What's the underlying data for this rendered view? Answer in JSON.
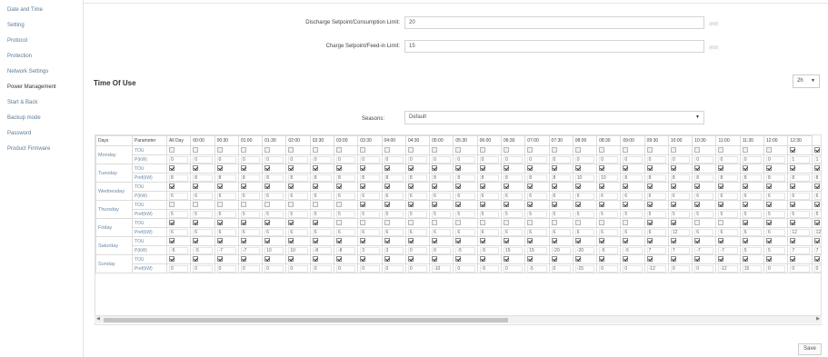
{
  "sidebar": {
    "items": [
      {
        "label": "Date and Time"
      },
      {
        "label": "Setting"
      },
      {
        "label": "Protocol"
      },
      {
        "label": "Protection"
      },
      {
        "label": "Network Settings"
      },
      {
        "label": "Power Management"
      },
      {
        "label": "Start & Back"
      },
      {
        "label": "Backup mode"
      },
      {
        "label": "Password"
      },
      {
        "label": "Product Firmware"
      }
    ]
  },
  "form": {
    "discharge_label": "Discharge Setpoint/Consumption Limit:",
    "discharge_value": "20",
    "discharge_unit": "(kW)",
    "charge_label": "Charge Setpoint/Feed-in Limit:",
    "charge_value": "15",
    "charge_unit": "(kW)"
  },
  "tou": {
    "title": "Time Of Use",
    "interval_value": "2h",
    "season_label": "Seasons:",
    "season_value": "Default"
  },
  "table": {
    "headers": [
      "Days",
      "Parameter",
      "All Day",
      "00:00",
      "00:30",
      "01:00",
      "01:30",
      "02:00",
      "02:30",
      "03:00",
      "03:30",
      "04:00",
      "04:30",
      "05:00",
      "05:30",
      "06:00",
      "06:30",
      "07:00",
      "07:30",
      "08:00",
      "08:30",
      "09:00",
      "09:30",
      "10:00",
      "10:30",
      "11:00",
      "11:30",
      "12:00",
      "12:30"
    ],
    "rows": [
      {
        "day": "Monday",
        "tou_label": "TOU",
        "pref_label": "P(kW)",
        "checks": [
          false,
          false,
          false,
          false,
          false,
          false,
          false,
          false,
          false,
          false,
          false,
          false,
          false,
          false,
          false,
          false,
          false,
          false,
          false,
          false,
          false,
          false,
          false,
          false,
          false,
          false,
          true,
          true
        ],
        "values": [
          "0",
          "0",
          "0",
          "0",
          "0",
          "0",
          "0",
          "0",
          "0",
          "0",
          "0",
          "0",
          "0",
          "0",
          "0",
          "0",
          "0",
          "0",
          "0",
          "0",
          "0",
          "0",
          "0",
          "0",
          "0",
          "0",
          "1",
          "1"
        ]
      },
      {
        "day": "Tuesday",
        "tou_label": "TOU",
        "pref_label": "Pref(kW)",
        "checks": [
          true,
          true,
          true,
          true,
          true,
          true,
          true,
          true,
          true,
          true,
          true,
          true,
          true,
          true,
          true,
          true,
          true,
          true,
          true,
          true,
          true,
          true,
          true,
          true,
          true,
          true,
          true,
          true
        ],
        "values": [
          "8",
          "8",
          "8",
          "8",
          "8",
          "8",
          "8",
          "8",
          "8",
          "8",
          "8",
          "8",
          "8",
          "8",
          "8",
          "8",
          "8",
          "10",
          "10",
          "8",
          "8",
          "8",
          "8",
          "8",
          "8",
          "8",
          "8",
          "8"
        ]
      },
      {
        "day": "Wednesday",
        "tou_label": "TOU",
        "pref_label": "P(kW)",
        "checks": [
          true,
          true,
          true,
          true,
          true,
          true,
          true,
          true,
          true,
          true,
          true,
          true,
          true,
          true,
          true,
          true,
          true,
          true,
          true,
          true,
          true,
          true,
          true,
          true,
          true,
          true,
          true,
          true
        ],
        "values": [
          "6",
          "6",
          "6",
          "6",
          "6",
          "6",
          "6",
          "6",
          "6",
          "6",
          "6",
          "6",
          "6",
          "6",
          "6",
          "6",
          "6",
          "6",
          "6",
          "6",
          "6",
          "6",
          "6",
          "6",
          "6",
          "6",
          "6",
          "6"
        ]
      },
      {
        "day": "Thursday",
        "tou_label": "TOU",
        "pref_label": "Pref(kW)",
        "checks": [
          false,
          false,
          false,
          false,
          false,
          false,
          false,
          false,
          true,
          true,
          true,
          true,
          true,
          true,
          true,
          true,
          true,
          true,
          true,
          true,
          true,
          true,
          true,
          true,
          true,
          true,
          true,
          true
        ],
        "values": [
          "5",
          "5",
          "5",
          "5",
          "5",
          "5",
          "5",
          "5",
          "5",
          "5",
          "5",
          "5",
          "5",
          "5",
          "5",
          "5",
          "5",
          "5",
          "5",
          "5",
          "5",
          "5",
          "5",
          "5",
          "5",
          "5",
          "5",
          "5"
        ]
      },
      {
        "day": "Friday",
        "tou_label": "TOU",
        "pref_label": "Pref(kW)",
        "checks": [
          true,
          true,
          true,
          true,
          true,
          true,
          true,
          false,
          false,
          false,
          false,
          false,
          false,
          false,
          false,
          false,
          false,
          false,
          false,
          false,
          true,
          true,
          false,
          false,
          true,
          true,
          true,
          true
        ],
        "values": [
          "6",
          "6",
          "6",
          "6",
          "6",
          "6",
          "6",
          "6",
          "6",
          "6",
          "6",
          "6",
          "6",
          "6",
          "6",
          "6",
          "6",
          "6",
          "6",
          "6",
          "6",
          "12",
          "6",
          "6",
          "6",
          "6",
          "12",
          "12"
        ]
      },
      {
        "day": "Saturday",
        "tou_label": "TOU",
        "pref_label": "P(kW)",
        "checks": [
          true,
          true,
          true,
          true,
          true,
          true,
          true,
          true,
          true,
          true,
          true,
          true,
          true,
          true,
          true,
          true,
          true,
          true,
          true,
          true,
          true,
          true,
          true,
          true,
          true,
          true,
          true,
          true
        ],
        "values": [
          "-5",
          "-5",
          "-7",
          "-7",
          "10",
          "10",
          "-8",
          "-8",
          "3",
          "3",
          "0",
          "0",
          "-5",
          "-5",
          "15",
          "15",
          "-20",
          "-20",
          "-5",
          "-5",
          "7",
          "7",
          "-7",
          "-7",
          "5",
          "5",
          "7",
          "7"
        ]
      },
      {
        "day": "Sunday",
        "tou_label": "TOU",
        "pref_label": "Pref(kW)",
        "checks": [
          true,
          true,
          true,
          true,
          true,
          true,
          true,
          true,
          true,
          true,
          true,
          true,
          true,
          true,
          true,
          true,
          true,
          true,
          true,
          true,
          true,
          true,
          true,
          true,
          true,
          true,
          true,
          true
        ],
        "values": [
          "0",
          "0",
          "0",
          "0",
          "0",
          "0",
          "0",
          "0",
          "0",
          "0",
          "0",
          "-10",
          "0",
          "-5",
          "0",
          "-5",
          "0",
          "-15",
          "0",
          "0",
          "-12",
          "0",
          "0",
          "-12",
          "15",
          "0",
          "0",
          "0"
        ]
      }
    ]
  },
  "actions": {
    "save_label": "Save"
  }
}
